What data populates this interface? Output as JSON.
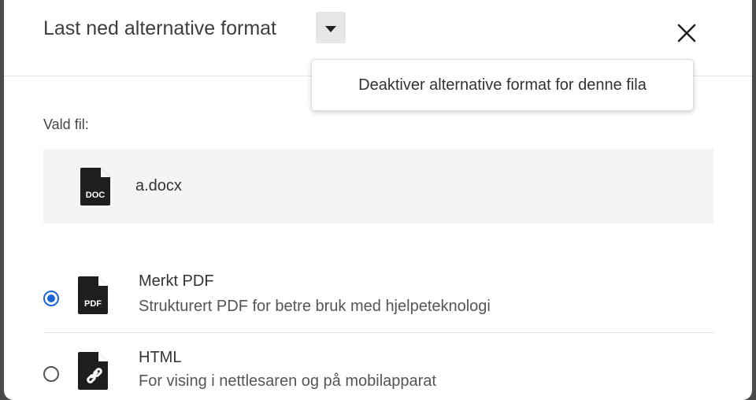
{
  "header": {
    "title": "Last ned alternative format",
    "toggle_icon": "caret-down-icon",
    "close_icon": "close-icon"
  },
  "menu": {
    "items": [
      {
        "label": "Deaktiver alternative format for denne fila"
      }
    ]
  },
  "selected_file": {
    "label": "Vald fil:",
    "name": "a.docx",
    "icon": "doc-file-icon",
    "icon_text": "DOC"
  },
  "options": [
    {
      "title": "Merkt PDF",
      "description": "Strukturert PDF for betre bruk med hjelpeteknologi",
      "icon": "pdf-file-icon",
      "icon_text": "PDF",
      "selected": true
    },
    {
      "title": "HTML",
      "description": "For vising i nettlesaren og på mobilapparat",
      "icon": "html-file-icon",
      "selected": false
    }
  ],
  "colors": {
    "accent": "#1a66d6",
    "background": "#ffffff",
    "file_box": "#f4f4f4"
  }
}
